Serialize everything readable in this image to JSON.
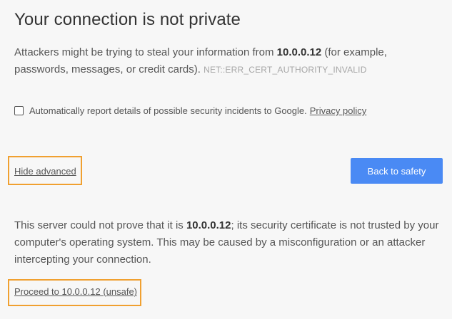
{
  "title": "Your connection is not private",
  "intro": {
    "before_host": "Attackers might be trying to steal your information from ",
    "host": "10.0.0.12",
    "after_host": " (for example, passwords, messages, or credit cards). ",
    "error_code": "NET::ERR_CERT_AUTHORITY_INVALID"
  },
  "report": {
    "checked": false,
    "label": "Automatically report details of possible security incidents to Google.",
    "privacy_link": "Privacy policy"
  },
  "hide_advanced": "Hide advanced",
  "back_button": "Back to safety",
  "details": {
    "before_host": "This server could not prove that it is ",
    "host": "10.0.0.12",
    "after_host": "; its security certificate is not trusted by your computer's operating system. This may be caused by a misconfiguration or an attacker intercepting your connection."
  },
  "proceed_link": "Proceed to 10.0.0.12 (unsafe)",
  "colors": {
    "background": "#f7f7f7",
    "button": "#4a8af4",
    "highlight_box": "#f0a030"
  }
}
